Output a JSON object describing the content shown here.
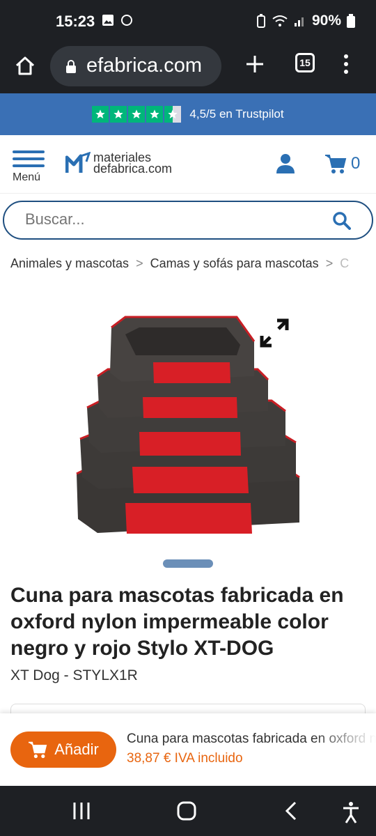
{
  "status": {
    "time": "15:23",
    "battery": "90%"
  },
  "browser": {
    "url": "efabrica.com",
    "tab_count": "15"
  },
  "trust": {
    "rating_text": "4,5/5 en Trustpilot"
  },
  "header": {
    "menu_label": "Menú",
    "logo_line1": "materiales",
    "logo_line2": "defabrica.com",
    "cart_count": "0"
  },
  "search": {
    "placeholder": "Buscar..."
  },
  "breadcrumb": {
    "items": [
      "Animales y mascotas",
      "Camas y sofás para mascotas",
      "C"
    ],
    "separator": ">"
  },
  "product": {
    "title": "Cuna para mascotas fabricada en oxford nylon impermeable color negro y rojo Stylo XT-DOG",
    "brand_sku": "XT Dog - STYLX1R"
  },
  "sticky": {
    "add_label": "Añadir",
    "name": "Cuna para mascotas fabricada en oxford nylon impermeable",
    "price": "38,87 €  IVA incluido"
  },
  "colors": {
    "brand_blue": "#2a6fb3",
    "trust_green": "#00b67a",
    "accent_orange": "#e8650f"
  }
}
